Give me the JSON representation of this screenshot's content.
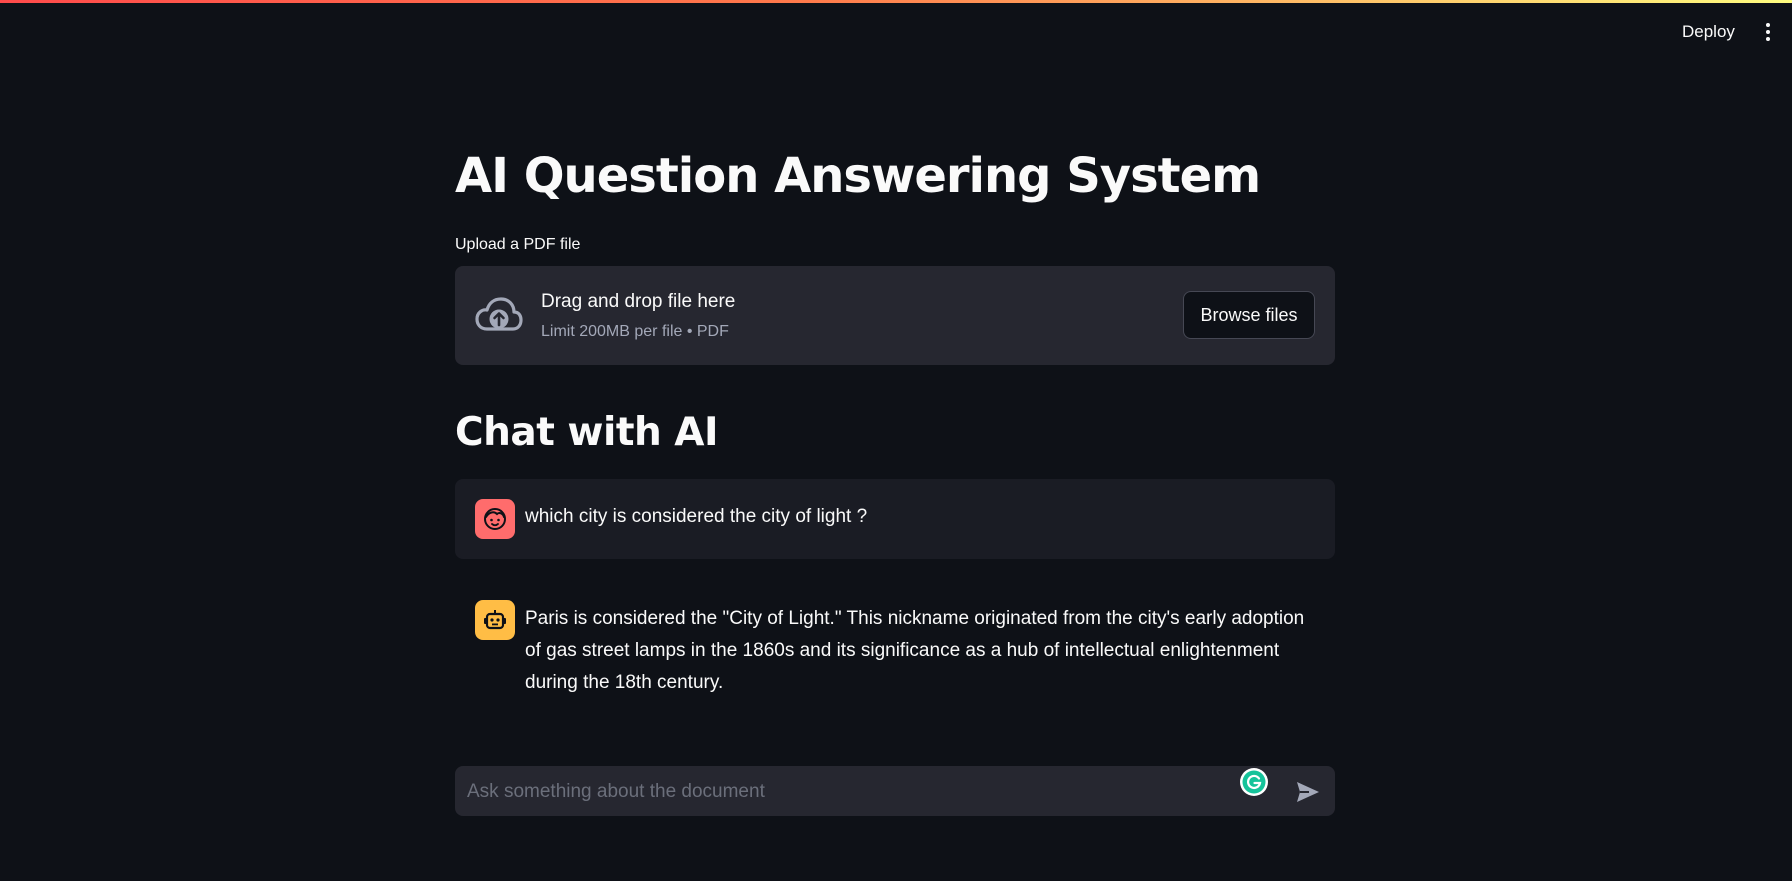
{
  "header": {
    "deploy_label": "Deploy",
    "menu_icon": "more-vertical-icon",
    "stripe_colors": [
      "#ff4b4b",
      "#fffd80"
    ]
  },
  "page": {
    "title": "AI Question Answering System"
  },
  "uploader": {
    "label": "Upload a PDF file",
    "drop_text": "Drag and drop file here",
    "limit_text": "Limit 200MB per file • PDF",
    "browse_label": "Browse files",
    "icon": "cloud-upload-icon"
  },
  "chat": {
    "heading": "Chat with AI",
    "messages": [
      {
        "role": "user",
        "avatar_icon": "user-face-icon",
        "avatar_color": "#ff6c6c",
        "text": "which city is considered the city of light ?"
      },
      {
        "role": "assistant",
        "avatar_icon": "robot-icon",
        "avatar_color": "#ffbd45",
        "text": "Paris is considered the \"City of Light.\" This nickname originated from the city's early adoption of gas street lamps in the 1860s and its significance as a hub of intellectual enlightenment during the 18th century."
      }
    ],
    "input": {
      "placeholder": "Ask something about the document",
      "value": ""
    },
    "send_icon": "send-icon",
    "extension_icon": "grammarly-icon"
  },
  "colors": {
    "background": "#0e1117",
    "surface": "#262730",
    "user_message_bg": "#1a1c24",
    "text": "#fafafa",
    "muted_text": "#a3a8b8",
    "grammarly": "#15c39a"
  }
}
